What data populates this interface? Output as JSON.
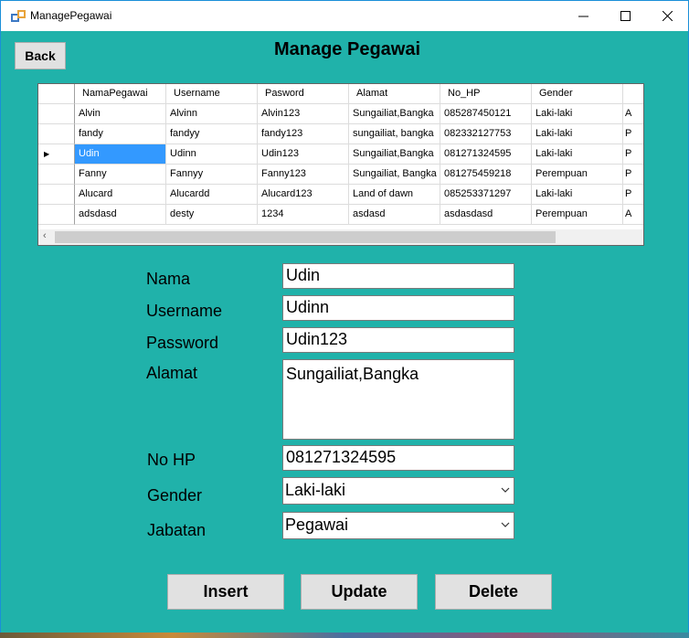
{
  "window": {
    "title": "ManagePegawai",
    "colors": {
      "background": "#20B2AA",
      "selection": "#3399FF"
    }
  },
  "titlebar": {
    "icons": [
      "app-icon",
      "minimize-icon",
      "maximize-icon",
      "close-icon"
    ]
  },
  "back_label": "Back",
  "page_title": "Manage Pegawai",
  "table": {
    "columns": [
      "NamaPegawai",
      "Username",
      "Pasword",
      "Alamat",
      "No_HP",
      "Gender"
    ],
    "rows": [
      [
        "Alvin",
        "Alvinn",
        "Alvin123",
        "Sungailiat,Bangka",
        "085287450121",
        "Laki-laki",
        "A"
      ],
      [
        "fandy",
        "fandyy",
        "fandy123",
        "sungailiat, bangka",
        "082332127753",
        "Laki-laki",
        "P"
      ],
      [
        "Udin",
        "Udinn",
        "Udin123",
        "Sungailiat,Bangka",
        "081271324595",
        "Laki-laki",
        "P"
      ],
      [
        "Fanny",
        "Fannyy",
        "Fanny123",
        "Sungailiat, Bangka",
        "081275459218",
        "Perempuan",
        "P"
      ],
      [
        "Alucard",
        "Alucardd",
        "Alucard123",
        "Land of dawn",
        "085253371297",
        "Laki-laki",
        "P"
      ],
      [
        "adsdasd",
        "desty",
        "1234",
        "asdasd",
        "asdasdasd",
        "Perempuan",
        "A"
      ]
    ],
    "selected_row": 2
  },
  "form": {
    "nama_label": "Nama",
    "nama_value": "Udin",
    "username_label": "Username",
    "username_value": "Udinn",
    "password_label": "Password",
    "password_value": "Udin123",
    "alamat_label": "Alamat",
    "alamat_value": "Sungailiat,Bangka",
    "nohp_label": "No HP",
    "nohp_value": "081271324595",
    "gender_label": "Gender",
    "gender_value": "Laki-laki",
    "jabatan_label": "Jabatan",
    "jabatan_value": "Pegawai"
  },
  "buttons": {
    "insert": "Insert",
    "update": "Update",
    "delete": "Delete"
  }
}
